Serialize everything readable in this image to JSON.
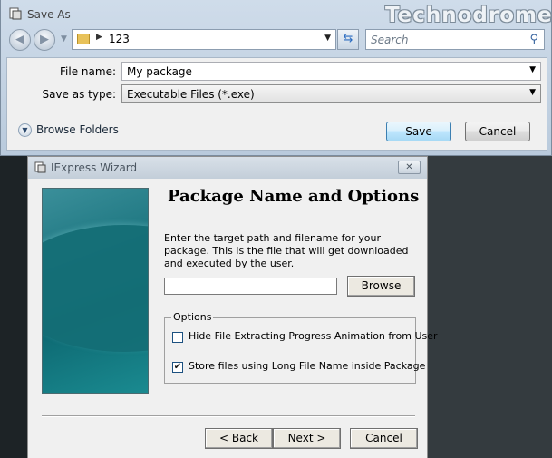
{
  "save_as": {
    "title": "Save As",
    "watermark": "Technodrome",
    "address": {
      "path": "123"
    },
    "search": {
      "placeholder": "Search"
    },
    "file_name": {
      "label": "File name:",
      "value": "My package"
    },
    "save_as_type": {
      "label": "Save as type:",
      "value": "Executable Files (*.exe)"
    },
    "browse_folders": "Browse Folders",
    "save_label": "Save",
    "cancel_label": "Cancel"
  },
  "wizard": {
    "title": "IExpress Wizard",
    "heading": "Package Name and Options",
    "description": "Enter the target path and filename for your package. This is the file that will get downloaded and executed by the user.",
    "path_value": "",
    "browse_label": "Browse",
    "options": {
      "legend": "Options",
      "items": [
        {
          "label": "Hide File Extracting Progress Animation from User",
          "checked": false
        },
        {
          "label": "Store files using Long File Name inside Package",
          "checked": true
        }
      ]
    },
    "back_label": "< Back",
    "next_label": "Next >",
    "cancel_label": "Cancel"
  },
  "icons": {
    "back": "back-arrow-icon",
    "forward": "forward-arrow-icon",
    "folder": "folder-icon",
    "refresh": "refresh-icon",
    "search": "magnifier-icon",
    "close": "close-icon"
  }
}
